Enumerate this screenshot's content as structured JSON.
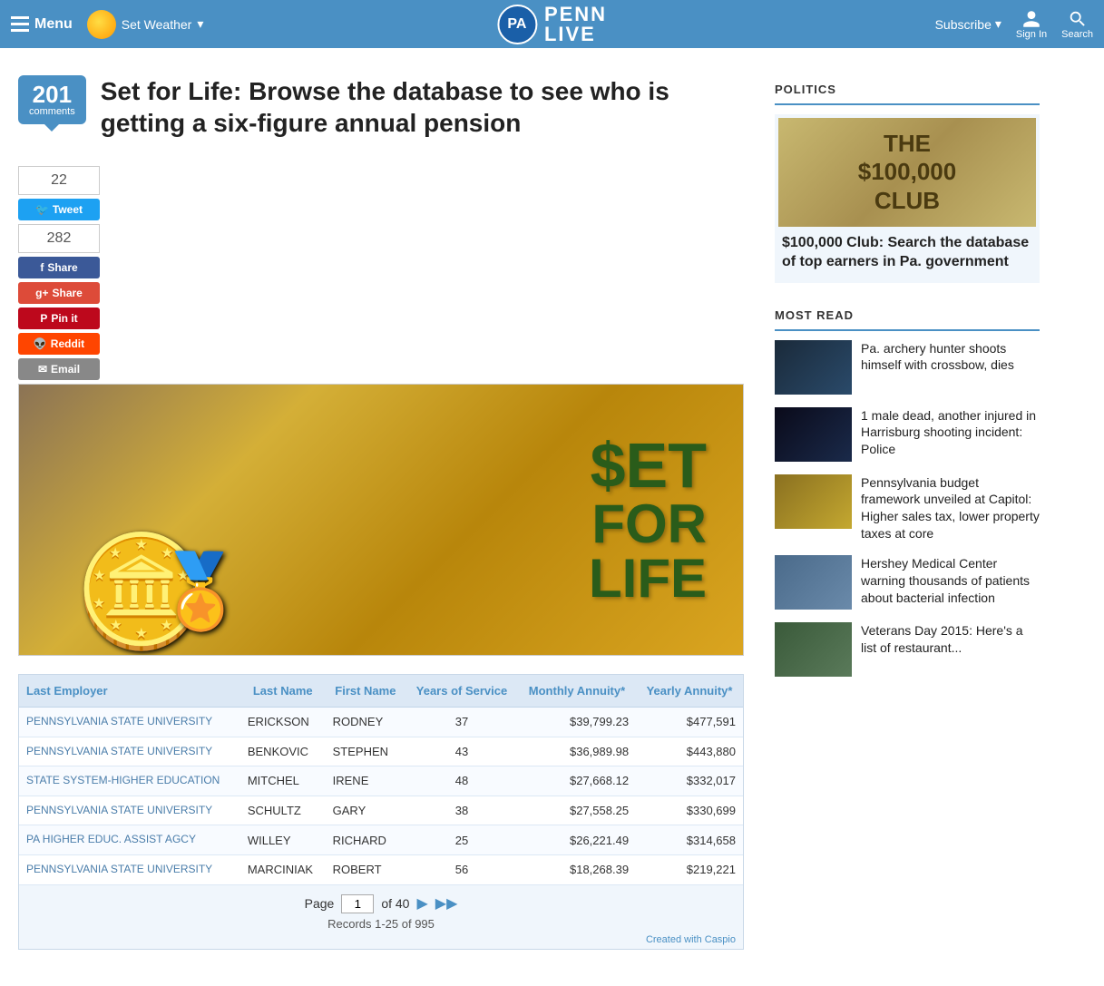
{
  "header": {
    "menu_label": "Menu",
    "weather_label": "Set Weather",
    "subscribe_label": "Subscribe",
    "sign_in_label": "Sign In",
    "search_label": "Search",
    "logo_pa": "PA",
    "logo_penn": "PENN",
    "logo_live": "LIVE"
  },
  "article": {
    "comment_count": "201",
    "comment_word": "comments",
    "title": "Set for Life: Browse the database to see who is getting a six-figure annual pension"
  },
  "social": {
    "tweet_count": "22",
    "tweet_label": "Tweet",
    "share_count": "282",
    "facebook_label": "Share",
    "gplus_label": "Share",
    "pinterest_label": "Pin it",
    "reddit_label": "Reddit",
    "email_label": "Email"
  },
  "table": {
    "headers": {
      "employer": "Last Employer",
      "last_name": "Last Name",
      "first_name": "First Name",
      "years": "Years of Service",
      "monthly": "Monthly Annuity*",
      "yearly": "Yearly Annuity*"
    },
    "rows": [
      {
        "employer": "PENNSYLVANIA STATE UNIVERSITY",
        "last_name": "ERICKSON",
        "first_name": "RODNEY",
        "years": "37",
        "monthly": "$39,799.23",
        "yearly": "$477,591"
      },
      {
        "employer": "PENNSYLVANIA STATE UNIVERSITY",
        "last_name": "BENKOVIC",
        "first_name": "STEPHEN",
        "years": "43",
        "monthly": "$36,989.98",
        "yearly": "$443,880"
      },
      {
        "employer": "STATE SYSTEM-HIGHER EDUCATION",
        "last_name": "MITCHEL",
        "first_name": "IRENE",
        "years": "48",
        "monthly": "$27,668.12",
        "yearly": "$332,017"
      },
      {
        "employer": "PENNSYLVANIA STATE UNIVERSITY",
        "last_name": "SCHULTZ",
        "first_name": "GARY",
        "years": "38",
        "monthly": "$27,558.25",
        "yearly": "$330,699"
      },
      {
        "employer": "PA HIGHER EDUC. ASSIST AGCY",
        "last_name": "WILLEY",
        "first_name": "RICHARD",
        "years": "25",
        "monthly": "$26,221.49",
        "yearly": "$314,658"
      },
      {
        "employer": "PENNSYLVANIA STATE UNIVERSITY",
        "last_name": "MARCINIAK",
        "first_name": "ROBERT",
        "years": "56",
        "monthly": "$18,268.39",
        "yearly": "$219,221"
      }
    ],
    "pagination": {
      "page_label": "Page",
      "current_page": "1",
      "total_pages": "40",
      "records_label": "Records 1-25 of 995",
      "caspio_credit": "Created with Caspio"
    }
  },
  "sidebar": {
    "politics_section": "POLITICS",
    "featured": {
      "title": "$100,000 Club: Search the database of top earners in Pa. government",
      "img_text": "THE $100,000 CLUB"
    },
    "most_read_section": "MOST READ",
    "most_read_items": [
      {
        "title": "Pa. archery hunter shoots himself with crossbow, dies",
        "thumb_class": "blue-dark"
      },
      {
        "title": "1 male dead, another injured in Harrisburg shooting incident: Police",
        "thumb_class": "dark-scene"
      },
      {
        "title": "Pennsylvania budget framework unveiled at Capitol: Higher sales tax, lower property taxes at core",
        "thumb_class": "gold-dome"
      },
      {
        "title": "Hershey Medical Center warning thousands of patients about bacterial infection",
        "thumb_class": "hershey"
      },
      {
        "title": "Veterans Day 2015: Here's a list of restaurant...",
        "thumb_class": "vet"
      }
    ]
  }
}
